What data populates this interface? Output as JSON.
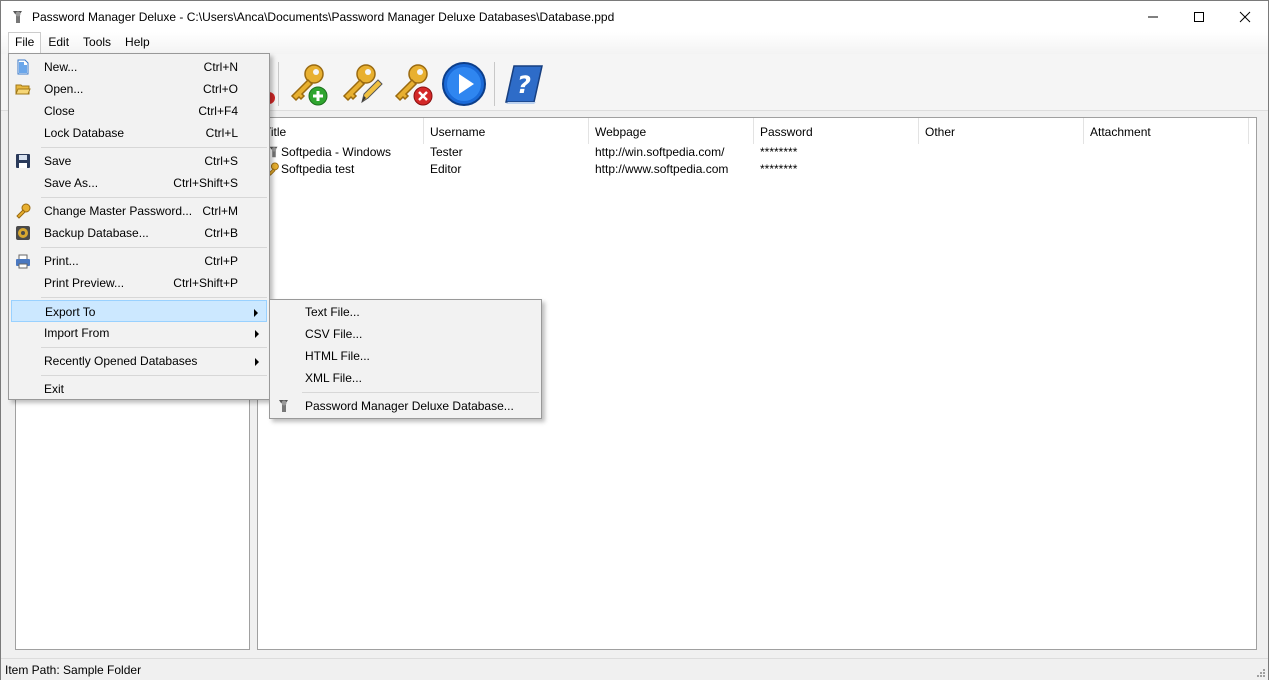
{
  "window": {
    "title": "Password Manager Deluxe - C:\\Users\\Anca\\Documents\\Password Manager Deluxe Databases\\Database.ppd"
  },
  "menubar": {
    "items": [
      {
        "label": "File"
      },
      {
        "label": "Edit"
      },
      {
        "label": "Tools"
      },
      {
        "label": "Help"
      }
    ]
  },
  "file_menu": {
    "items": [
      {
        "label": "New...",
        "shortcut": "Ctrl+N",
        "icon": "new-file-icon"
      },
      {
        "label": "Open...",
        "shortcut": "Ctrl+O",
        "icon": "open-folder-icon"
      },
      {
        "label": "Close",
        "shortcut": "Ctrl+F4"
      },
      {
        "label": "Lock Database",
        "shortcut": "Ctrl+L"
      },
      {
        "label": "Save",
        "shortcut": "Ctrl+S",
        "icon": "floppy-disk-icon"
      },
      {
        "label": "Save As...",
        "shortcut": "Ctrl+Shift+S"
      },
      {
        "label": "Change Master Password...",
        "shortcut": "Ctrl+M",
        "icon": "key-icon"
      },
      {
        "label": "Backup Database...",
        "shortcut": "Ctrl+B",
        "icon": "backup-icon"
      },
      {
        "label": "Print...",
        "shortcut": "Ctrl+P",
        "icon": "printer-icon"
      },
      {
        "label": "Print Preview...",
        "shortcut": "Ctrl+Shift+P"
      },
      {
        "label": "Export To"
      },
      {
        "label": "Import From"
      },
      {
        "label": "Recently Opened Databases"
      },
      {
        "label": "Exit"
      }
    ]
  },
  "export_menu": {
    "items": [
      {
        "label": "Text File..."
      },
      {
        "label": "CSV File..."
      },
      {
        "label": "HTML File..."
      },
      {
        "label": "XML File..."
      },
      {
        "label": "Password Manager Deluxe Database...",
        "icon": "app-icon"
      }
    ]
  },
  "table": {
    "columns": [
      "Title",
      "Username",
      "Webpage",
      "Password",
      "Other",
      "Attachment"
    ],
    "rows": [
      {
        "title": "Softpedia - Windows",
        "username": "Tester",
        "webpage": "http://win.softpedia.com/",
        "password": "********",
        "other": "",
        "attachment": ""
      },
      {
        "title": "Softpedia test",
        "username": "Editor",
        "webpage": "http://www.softpedia.com",
        "password": "********",
        "other": "",
        "attachment": ""
      }
    ]
  },
  "statusbar": {
    "text": "Item Path: Sample Folder"
  },
  "colors": {
    "highlight": "#cce8ff",
    "highlight_border": "#99d1ff",
    "key_gold": "#e8b030",
    "add_green": "#2fa52f",
    "delete_red": "#d32828",
    "play_blue": "#1a6ad8"
  }
}
